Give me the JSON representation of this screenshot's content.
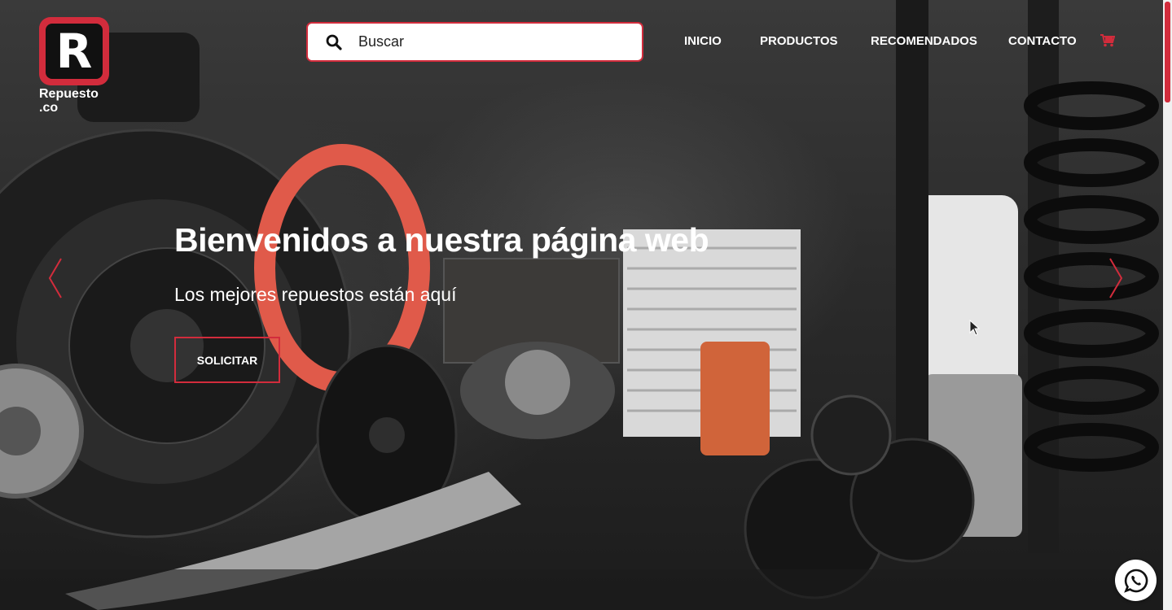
{
  "brand": {
    "logo_letter": "R",
    "name_line1": "Repuesto",
    "name_line2": ".co",
    "accent_color": "#d22c3c"
  },
  "search": {
    "placeholder": "Buscar",
    "icon": "search-icon"
  },
  "nav": {
    "items": [
      {
        "label": "INICIO"
      },
      {
        "label": "PRODUCTOS"
      },
      {
        "label": "RECOMENDADOS"
      },
      {
        "label": "CONTACTO"
      }
    ],
    "cart_icon": "cart-icon"
  },
  "hero": {
    "title": "Bienvenidos a nuestra página web",
    "subtitle": "Los mejores repuestos están aquí",
    "cta_label": "SOLICITAR",
    "prev_icon": "chevron-left-icon",
    "next_icon": "chevron-right-icon"
  },
  "floating": {
    "whatsapp_icon": "whatsapp-icon"
  }
}
